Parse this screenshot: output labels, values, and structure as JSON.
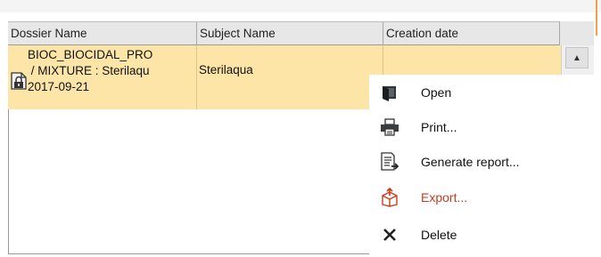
{
  "table": {
    "columns": [
      "Dossier Name",
      "Subject Name",
      "Creation date"
    ],
    "rows": [
      {
        "dossier_name": "BIOC_BIOCIDAL_PRO\n / MIXTURE : Sterilaqu\n2017-09-21",
        "subject_name": "Sterilaqua",
        "creation_date": ""
      }
    ]
  },
  "context_menu": {
    "items": [
      {
        "label": "Open",
        "icon": "open-icon"
      },
      {
        "label": "Print...",
        "icon": "printer-icon"
      },
      {
        "label": "Generate report...",
        "icon": "report-icon"
      },
      {
        "label": "Export...",
        "icon": "export-icon",
        "color": "#cc3a1e"
      },
      {
        "label": "Delete",
        "icon": "delete-icon"
      }
    ]
  },
  "colors": {
    "selected_row": "#fde5a7",
    "header": "#e7e7e7",
    "export_text": "#cc3a1e"
  }
}
